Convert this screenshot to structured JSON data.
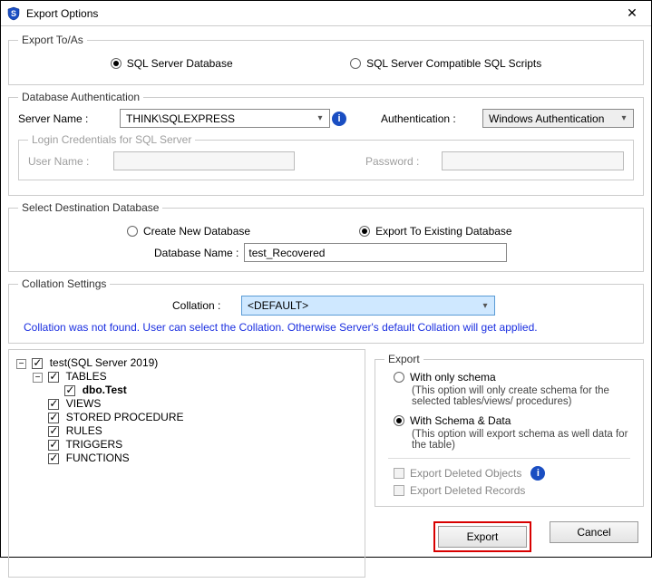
{
  "window": {
    "title": "Export Options"
  },
  "exportToAs": {
    "legend": "Export To/As",
    "opt1": "SQL Server Database",
    "opt2": "SQL Server Compatible SQL Scripts"
  },
  "dbAuth": {
    "legend": "Database Authentication",
    "serverNameLabel": "Server Name :",
    "serverNameValue": "THINK\\SQLEXPRESS",
    "authLabel": "Authentication :",
    "authValue": "Windows Authentication",
    "loginLegend": "Login Credentials for SQL Server",
    "userNameLabel": "User Name :",
    "passwordLabel": "Password :"
  },
  "destDb": {
    "legend": "Select Destination Database",
    "opt1": "Create New Database",
    "opt2": "Export To Existing Database",
    "dbNameLabel": "Database Name :",
    "dbNameValue": "test_Recovered"
  },
  "collation": {
    "legend": "Collation Settings",
    "label": "Collation :",
    "value": "<DEFAULT>",
    "message": "Collation was not found. User can select the Collation. Otherwise Server's default Collation will get applied."
  },
  "tree": {
    "root": "test(SQL Server 2019)",
    "n1": "TABLES",
    "n1a": "dbo.Test",
    "n2": "VIEWS",
    "n3": "STORED PROCEDURE",
    "n4": "RULES",
    "n5": "TRIGGERS",
    "n6": "FUNCTIONS"
  },
  "export": {
    "legend": "Export",
    "schemaOnly": "With only schema",
    "schemaOnlyDesc": "(This option will only create schema for the  selected tables/views/ procedures)",
    "schemaData": "With Schema & Data",
    "schemaDataDesc": "(This option will export schema as well data for the table)",
    "delObjects": "Export Deleted Objects",
    "delRecords": "Export Deleted Records"
  },
  "buttons": {
    "export": "Export",
    "cancel": "Cancel"
  }
}
